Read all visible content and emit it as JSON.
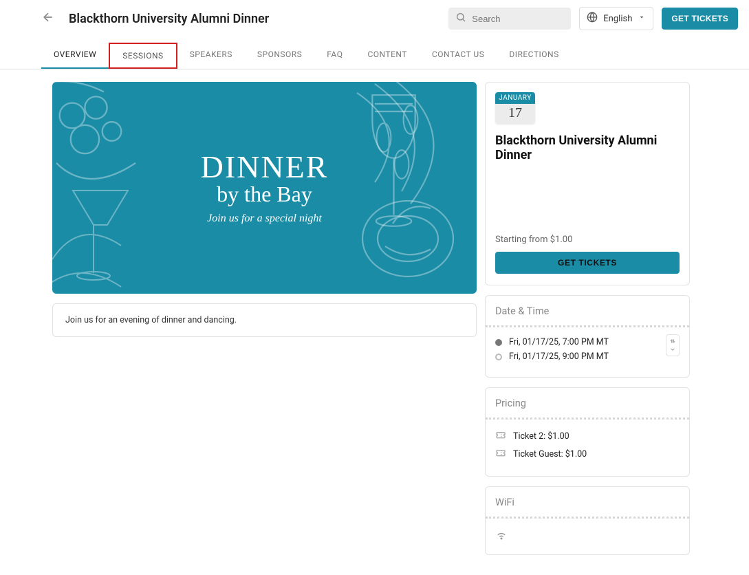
{
  "header": {
    "title": "Blackthorn University Alumni Dinner",
    "search_placeholder": "Search",
    "language": "English",
    "get_tickets": "GET TICKETS"
  },
  "tabs": [
    "OVERVIEW",
    "SESSIONS",
    "SPEAKERS",
    "SPONSORS",
    "FAQ",
    "CONTENT",
    "CONTACT US",
    "DIRECTIONS"
  ],
  "active_tab": 0,
  "highlight_tab": 1,
  "hero": {
    "line1": "DINNER",
    "line2": "by the Bay",
    "tagline": "Join us for a special night"
  },
  "description": "Join us for an evening of dinner and dancing.",
  "event": {
    "month": "JANUARY",
    "day": "17",
    "title": "Blackthorn University Alumni Dinner",
    "starting_from": "Starting from $1.00",
    "get_tickets": "GET TICKETS"
  },
  "datetime": {
    "section_title": "Date & Time",
    "start": "Fri, 01/17/25, 7:00 PM MT",
    "end": "Fri, 01/17/25, 9:00 PM MT"
  },
  "pricing": {
    "section_title": "Pricing",
    "items": [
      "Ticket 2: $1.00",
      "Ticket Guest: $1.00"
    ]
  },
  "wifi": {
    "section_title": "WiFi"
  }
}
